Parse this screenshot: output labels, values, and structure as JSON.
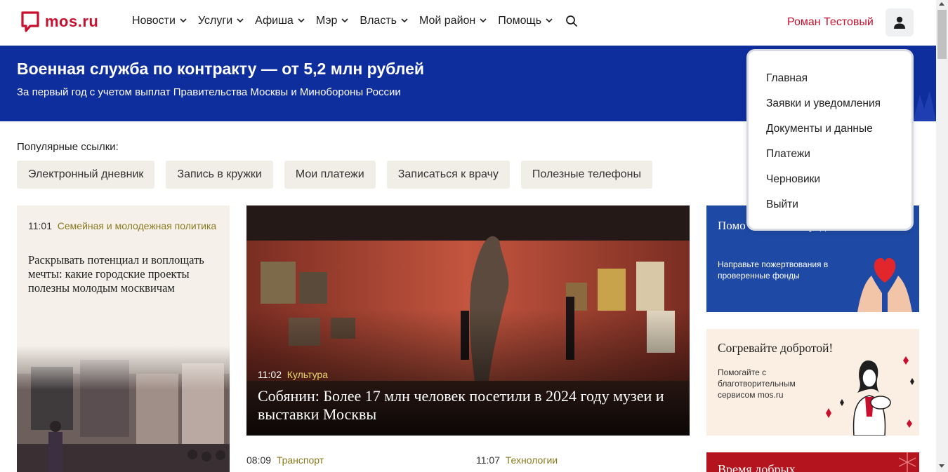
{
  "header": {
    "logo_text": "mos.ru",
    "nav": [
      {
        "label": "Новости"
      },
      {
        "label": "Услуги"
      },
      {
        "label": "Афиша"
      },
      {
        "label": "Мэр"
      },
      {
        "label": "Власть"
      },
      {
        "label": "Мой район"
      },
      {
        "label": "Помощь"
      }
    ],
    "user_name": "Роман Тестовый"
  },
  "banner": {
    "title": "Военная служба по контракту — от 5,2 млн рублей",
    "subtitle": "За первый год с учетом выплат Правительства Москвы и Минобороны России"
  },
  "popular": {
    "title": "Популярные ссылки:",
    "links": [
      "Электронный дневник",
      "Запись в кружки",
      "Мои платежи",
      "Записаться к врачу",
      "Полезные телефоны"
    ]
  },
  "news": {
    "left": {
      "time": "11:01",
      "category": "Семейная и молодежная политика",
      "title": "Раскрывать потенциал и воплощать мечты: какие городские проекты полезны молодым москвичам"
    },
    "center": {
      "time": "11:02",
      "category": "Культура",
      "title": "Собянин: Более 17 млн человек посетили в 2024 году музеи и выставки Москвы"
    },
    "bottom": [
      {
        "time": "08:09",
        "category": "Транспорт"
      },
      {
        "time": "11:07",
        "category": "Технологии"
      }
    ]
  },
  "promos": {
    "svo": {
      "title": "Помо СВО и пострадавшим жителям",
      "subtitle": "Направьте пожертвования в проверенные фонды"
    },
    "kindness": {
      "title": "Согревайте добротой!",
      "subtitle": "Помогайте с благотворительным сервисом mos.ru"
    },
    "time": {
      "title": "Время добрых"
    }
  },
  "user_menu": {
    "items": [
      "Главная",
      "Заявки и уведомления",
      "Документы и данные",
      "Платежи",
      "Черновики",
      "Выйти"
    ]
  },
  "colors": {
    "brand": "#c8102e",
    "banner": "#0f2e9d",
    "category": "#8a7a20"
  }
}
